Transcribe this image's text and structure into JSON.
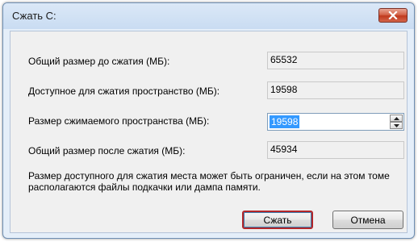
{
  "window": {
    "title": "Сжать C:"
  },
  "fields": {
    "total_before_label": "Общий размер до сжатия (МБ):",
    "total_before_value": "65532",
    "available_label": "Доступное для сжатия пространство (МБ):",
    "available_value": "19598",
    "shrink_label": "Размер сжимаемого пространства (МБ):",
    "shrink_value": "19598",
    "total_after_label": "Общий размер после сжатия (МБ):",
    "total_after_value": "45934"
  },
  "info": {
    "text": "Размер доступного для сжатия места может быть ограничен, если на этом томе располагаются файлы подкачки или дампа памяти."
  },
  "buttons": {
    "shrink_label": "Сжать",
    "cancel_label": "Отмена"
  },
  "icons": {
    "close": "close-icon",
    "spin_up": "spin-up-icon",
    "spin_down": "spin-down-icon"
  },
  "colors": {
    "selection": "#3399ff",
    "close_button": "#c0391d",
    "default_button_border": "#b3262a"
  }
}
